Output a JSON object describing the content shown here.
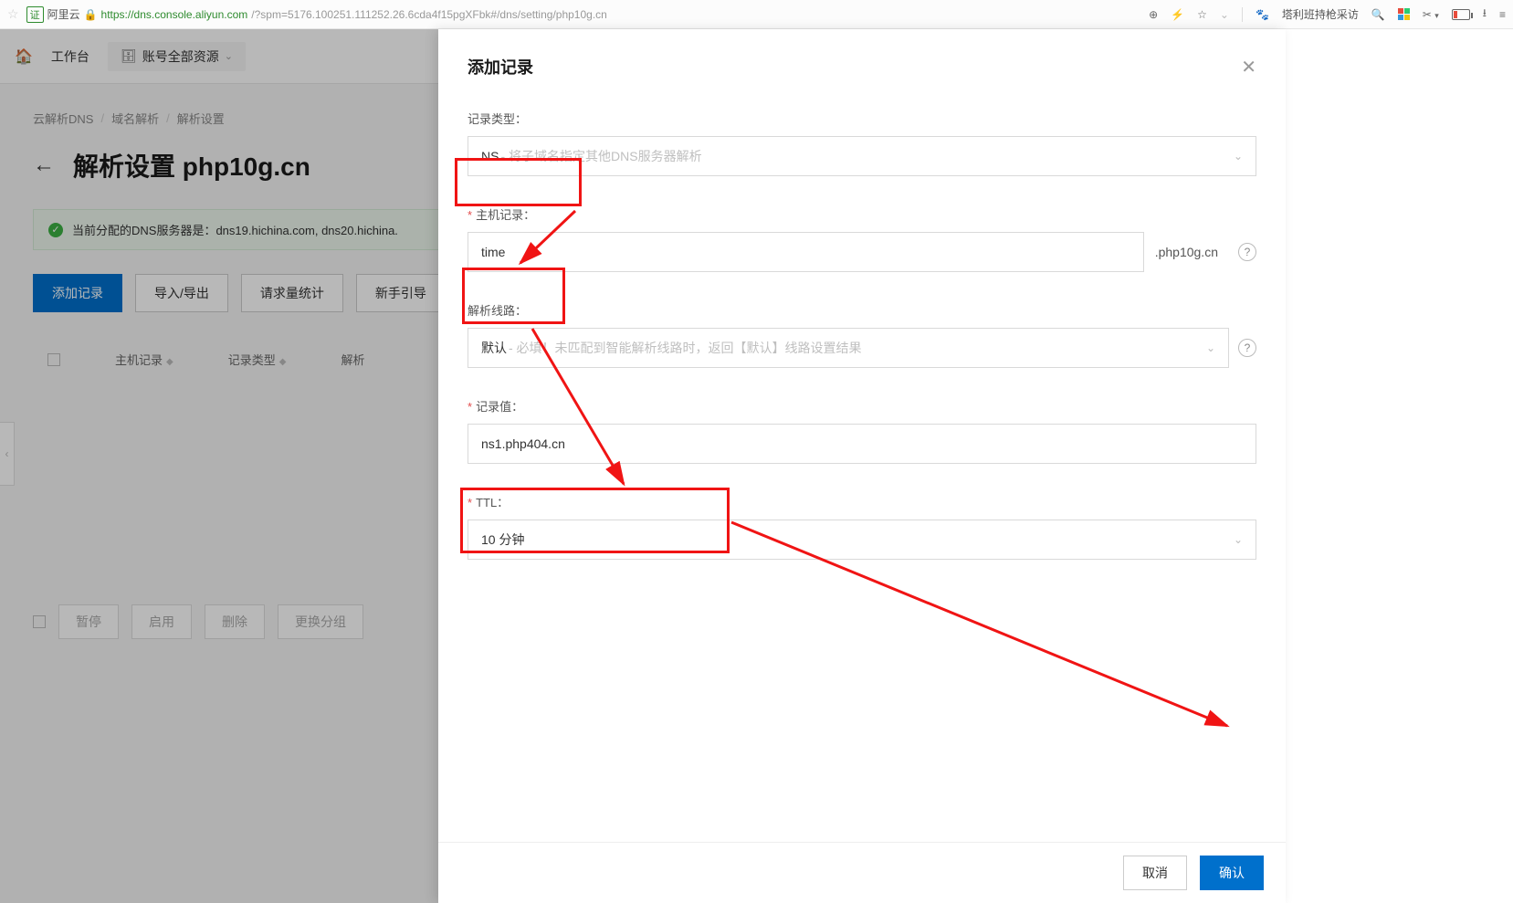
{
  "browser": {
    "site_name": "阿里云",
    "url_host": "https://dns.console.aliyun.com",
    "url_path": "/?spm=5176.100251.111252.26.6cda4f15pgXFbk#/dns/setting/php10g.cn",
    "news_text": "塔利班持枪采访"
  },
  "topbar": {
    "workbench": "工作台",
    "account_resources": "账号全部资源"
  },
  "breadcrumb": {
    "a": "云解析DNS",
    "b": "域名解析",
    "c": "解析设置"
  },
  "page": {
    "title": "解析设置 php10g.cn",
    "dns_info": "当前分配的DNS服务器是：dns19.hichina.com, dns20.hichina."
  },
  "buttons": {
    "add_record": "添加记录",
    "import_export": "导入/导出",
    "request_stats": "请求量统计",
    "guide": "新手引导",
    "pause": "暂停",
    "enable": "启用",
    "delete": "删除",
    "change_group": "更换分组"
  },
  "table": {
    "col_host": "主机记录",
    "col_type": "记录类型",
    "col_line_partial": "解析"
  },
  "drawer": {
    "title": "添加记录",
    "labels": {
      "record_type": "记录类型：",
      "host_record": "主机记录：",
      "line": "解析线路：",
      "record_value": "记录值：",
      "ttl": "TTL："
    },
    "record_type_prefix": "NS",
    "record_type_desc": "- 将子域名指定其他DNS服务器解析",
    "host_value": "time",
    "host_suffix": ".php10g.cn",
    "line_prefix": "默认",
    "line_desc": " - 必填！未匹配到智能解析线路时，返回【默认】线路设置结果",
    "record_value": "ns1.php404.cn",
    "ttl_value": "10 分钟",
    "cancel": "取消",
    "confirm": "确认"
  }
}
